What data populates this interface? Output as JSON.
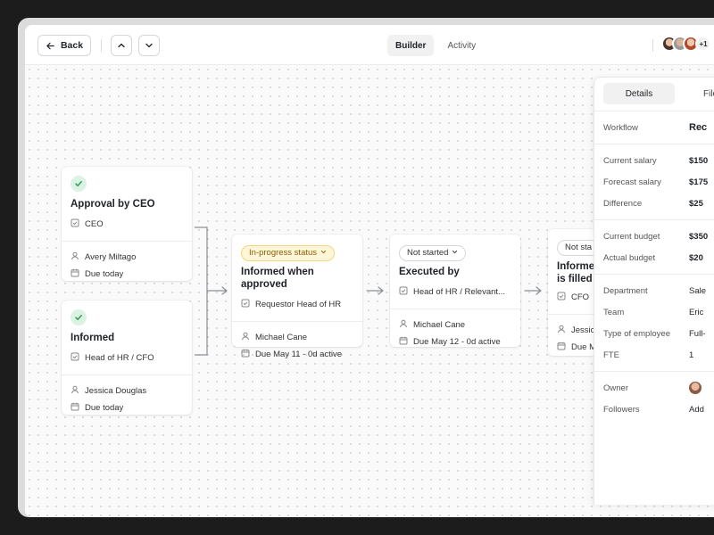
{
  "toolbar": {
    "back_label": "Back",
    "tabs": [
      {
        "label": "Builder",
        "active": true
      },
      {
        "label": "Activity",
        "active": false
      }
    ],
    "avatars_more": "+1"
  },
  "cards": {
    "approval_ceo": {
      "title": "Approval by CEO",
      "assignee_role": "CEO",
      "person": "Avery Miltago",
      "due": "Due today"
    },
    "informed": {
      "title": "Informed",
      "assignee_role": "Head of HR / CFO",
      "person": "Jessica Douglas",
      "due": "Due today"
    },
    "informed_approved": {
      "status": "In-progress status",
      "title": "Informed when approved",
      "assignee_role": "Requestor Head of HR",
      "person": "Michael Cane",
      "due": "Due May 11 - 0d active"
    },
    "executed_by": {
      "status": "Not started",
      "title": "Executed by",
      "assignee_role": "Head of HR / Relevant...",
      "person": "Michael Cane",
      "due": "Due May 12 - 0d active"
    },
    "informed_filled": {
      "status": "Not sta",
      "title_line1": "Informed",
      "title_line2": "is filled",
      "assignee_role": "CFO",
      "person": "Jessic",
      "due": "Due M"
    }
  },
  "panel": {
    "tabs": [
      {
        "label": "Details",
        "active": true
      },
      {
        "label": "File",
        "active": false
      }
    ],
    "workflow": {
      "label": "Workflow",
      "value": "Rec"
    },
    "salary": [
      {
        "label": "Current salary",
        "value": "$150"
      },
      {
        "label": "Forecast salary",
        "value": "$175"
      },
      {
        "label": "Difference",
        "value": "$25"
      }
    ],
    "budget": [
      {
        "label": "Current budget",
        "value": "$350"
      },
      {
        "label": "Actual budget",
        "value": "$20"
      }
    ],
    "org": [
      {
        "label": "Department",
        "value": "Sale"
      },
      {
        "label": "Team",
        "value": "Eric"
      },
      {
        "label": "Type of employee",
        "value": "Full-"
      },
      {
        "label": "FTE",
        "value": "1"
      }
    ],
    "owner": {
      "label": "Owner"
    },
    "followers": {
      "label": "Followers",
      "value": "Add"
    }
  },
  "colors": {
    "success": "#2f9e56",
    "progress_border": "#f4d77c",
    "progress_text": "#8a5d00"
  }
}
